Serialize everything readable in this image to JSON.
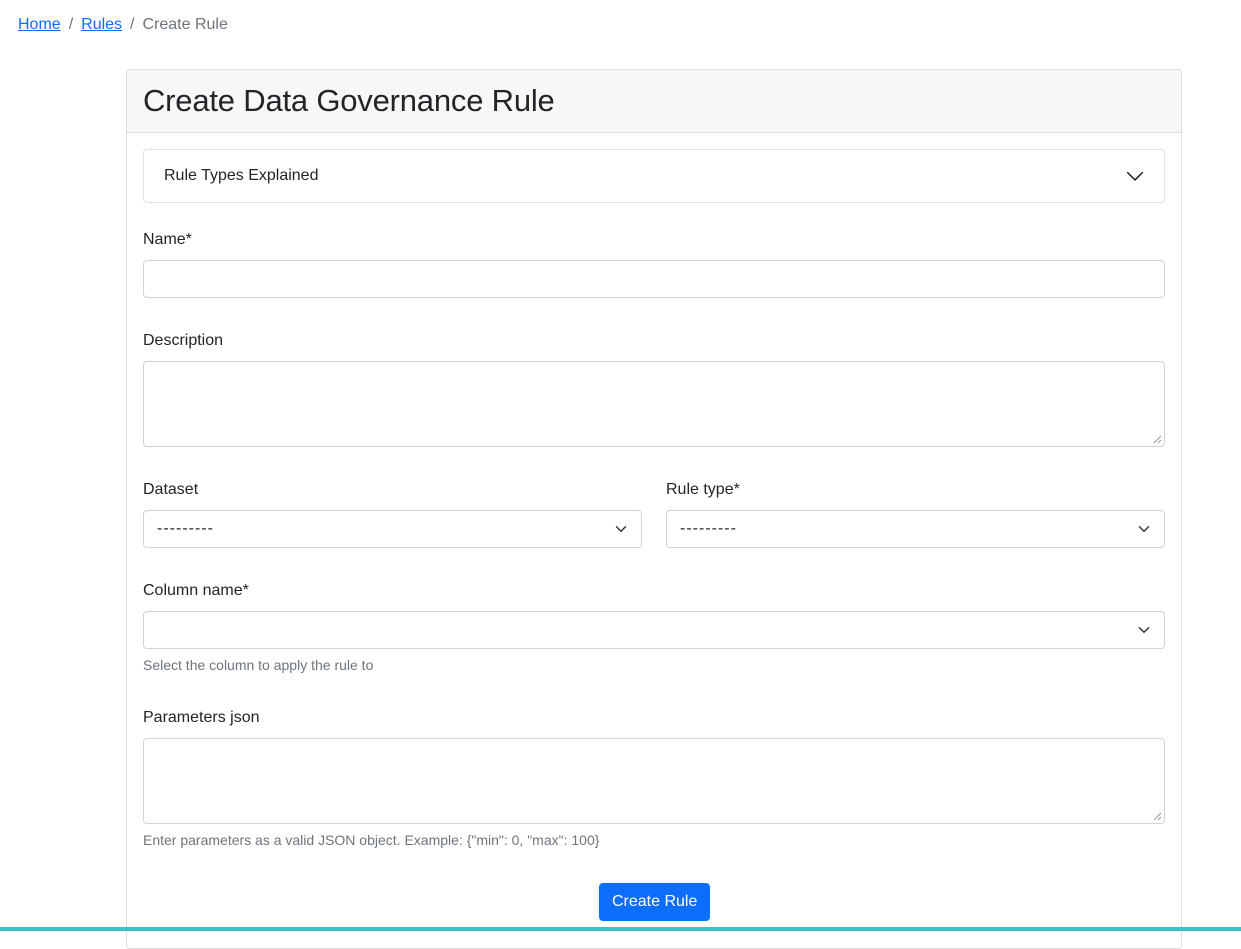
{
  "breadcrumb": {
    "home": "Home",
    "separator": "/",
    "rules": "Rules",
    "current": "Create Rule"
  },
  "card": {
    "title": "Create Data Governance Rule"
  },
  "accordion": {
    "label": "Rule Types Explained",
    "icon": "chevron-down-icon",
    "expanded": false
  },
  "form": {
    "name": {
      "label": "Name*",
      "value": ""
    },
    "description": {
      "label": "Description",
      "value": ""
    },
    "dataset": {
      "label": "Dataset",
      "value": "---------"
    },
    "rule_type": {
      "label": "Rule type*",
      "value": "---------"
    },
    "column_name": {
      "label": "Column name*",
      "value": "",
      "help": "Select the column to apply the rule to"
    },
    "parameters_json": {
      "label": "Parameters json",
      "value": "",
      "help": "Enter parameters as a valid JSON object. Example: {\"min\": 0, \"max\": 100}"
    },
    "submit_label": "Create Rule"
  },
  "colors": {
    "link": "#0d6efd",
    "primary_button": "#0d6efd",
    "muted_text": "#6c757d",
    "border": "#ced4da",
    "header_bg": "#f7f7f7",
    "bottom_bar": "#3fc1c9"
  }
}
